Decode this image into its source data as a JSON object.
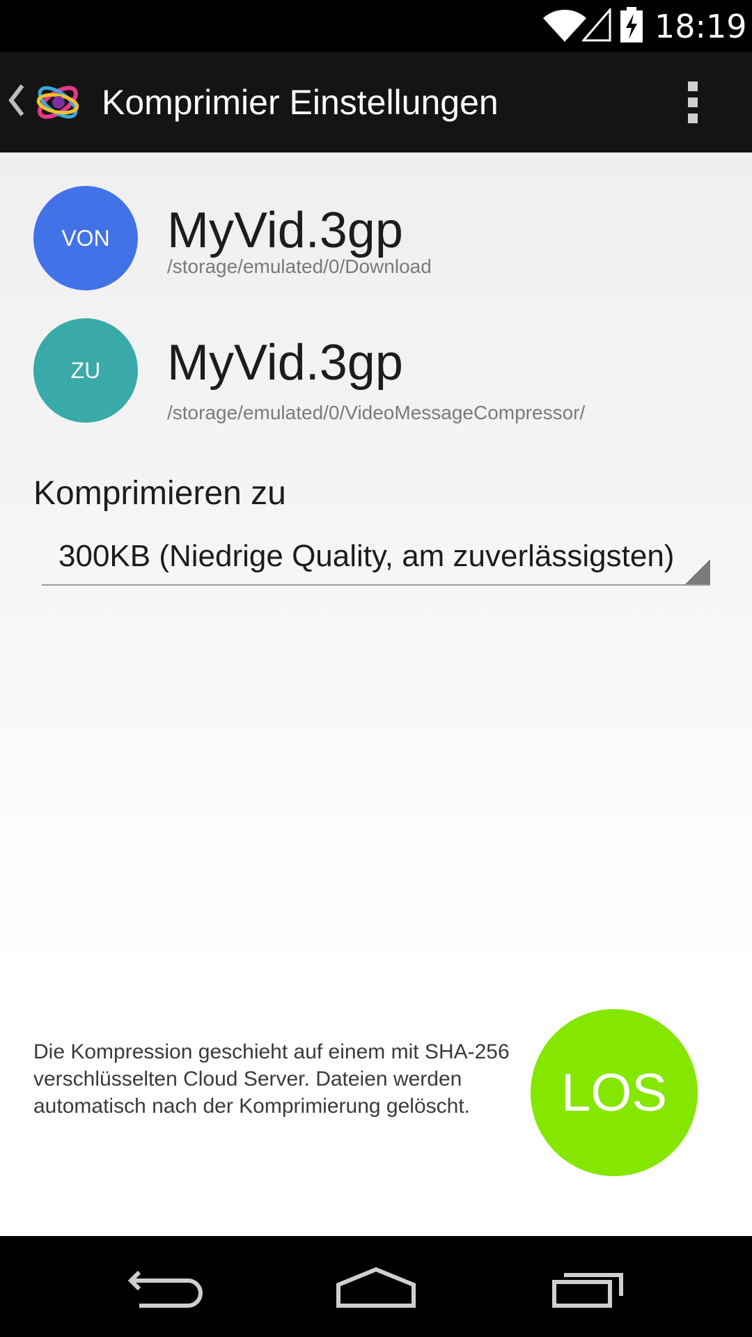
{
  "status_bar": {
    "time": "18:19",
    "icons": [
      "wifi-icon",
      "signal-icon",
      "battery-charging-icon"
    ]
  },
  "action_bar": {
    "title": "Komprimier Einstellungen",
    "icons": [
      "back-caret-icon",
      "app-logo-icon",
      "overflow-menu-icon"
    ]
  },
  "source": {
    "badge": "VON",
    "badge_color": "#4272e8",
    "file_name": "MyVid.3gp",
    "path": "/storage/emulated/0/Download"
  },
  "destination": {
    "badge": "ZU",
    "badge_color": "#39aaa7",
    "file_name": "MyVid.3gp",
    "path": "/storage/emulated/0/VideoMessageCompressor/"
  },
  "compress": {
    "label": "Komprimieren zu",
    "selected_option": "300KB (Niedrige Quality, am zuverlässigsten)"
  },
  "info": {
    "text": "Die Kompression geschieht auf einem mit SHA-256 verschlüsselten Cloud Server. Dateien werden automatisch nach der Komprimierung gelöscht."
  },
  "go_button": {
    "label": "LOS",
    "color": "#85e600"
  },
  "nav_bar": {
    "icons": [
      "back-icon",
      "home-icon",
      "recents-icon"
    ]
  }
}
